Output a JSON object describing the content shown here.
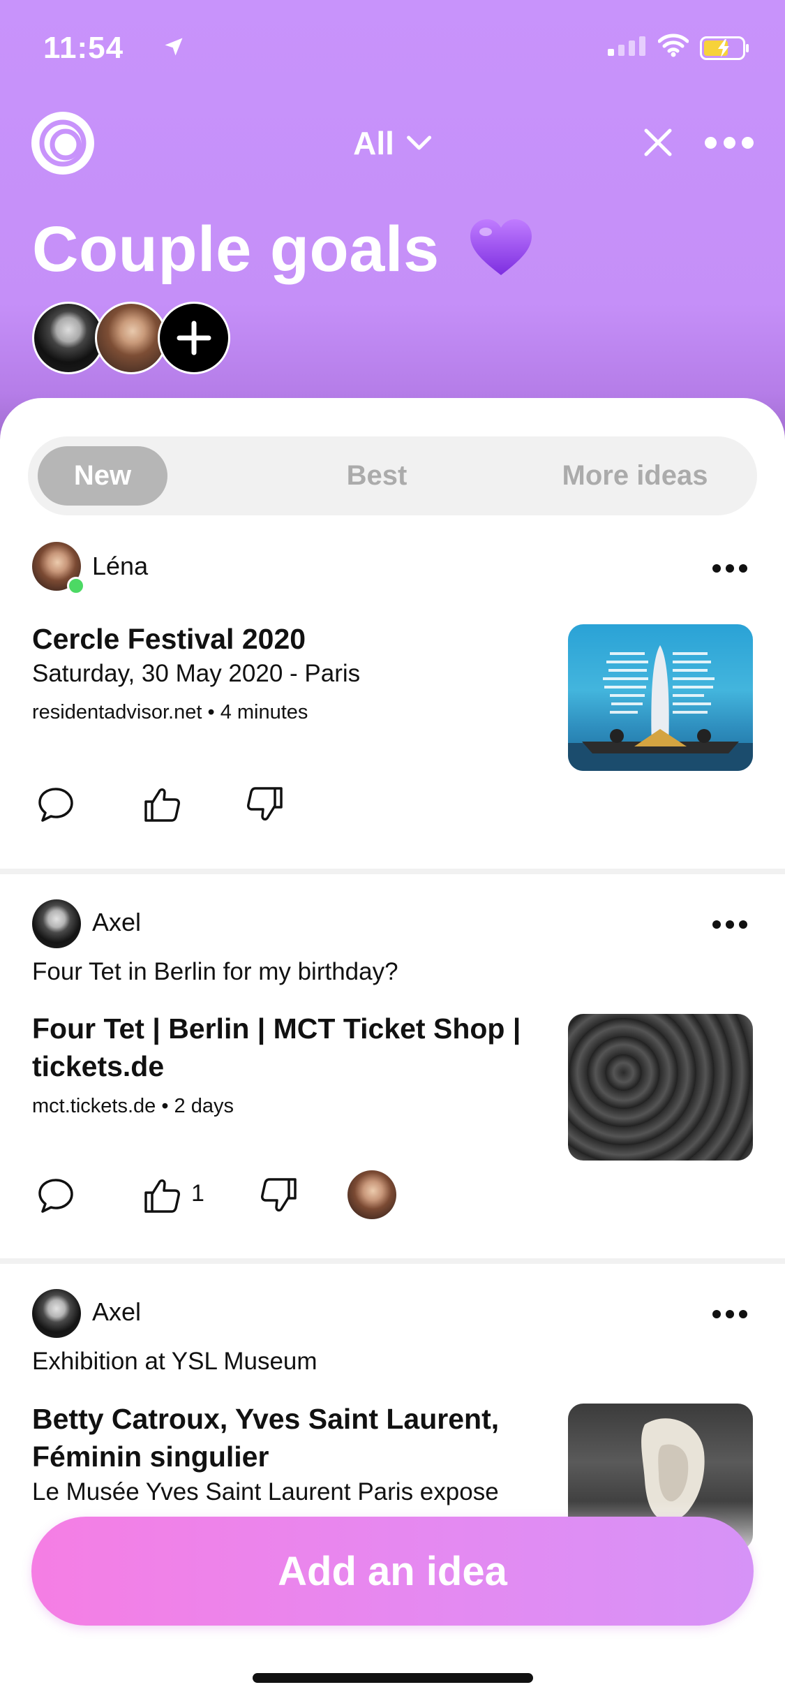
{
  "status_bar": {
    "time": "11:54"
  },
  "header": {
    "filter_label": "All",
    "title": "Couple goals",
    "title_emoji": "purple-heart-emoji"
  },
  "tabs": [
    {
      "label": "New",
      "selected": true
    },
    {
      "label": "Best",
      "selected": false
    },
    {
      "label": "More ideas",
      "selected": false
    }
  ],
  "cards": [
    {
      "author": "Léna",
      "online": true,
      "note": "",
      "title": "Cercle Festival 2020",
      "subtitle": "Saturday, 30 May 2020 - Paris",
      "meta": "residentadvisor.net • 4 minutes",
      "likes": ""
    },
    {
      "author": "Axel",
      "note": "Four Tet in Berlin for my birthday?",
      "title": "Four Tet | Berlin | MCT Ticket Shop | tickets.de",
      "meta": "mct.tickets.de • 2 days",
      "likes": "1"
    },
    {
      "author": "Axel",
      "note": "Exhibition at YSL Museum",
      "title": "Betty Catroux, Yves Saint Laurent, Féminin singulier",
      "subtitle": "Le Musée Yves Saint Laurent Paris expose"
    }
  ],
  "add_button_label": "Add an idea",
  "colors": {
    "header": "#c893fb",
    "add_button_start": "#f57ee4",
    "add_button_end": "#d693f7",
    "online": "#4cd964"
  }
}
